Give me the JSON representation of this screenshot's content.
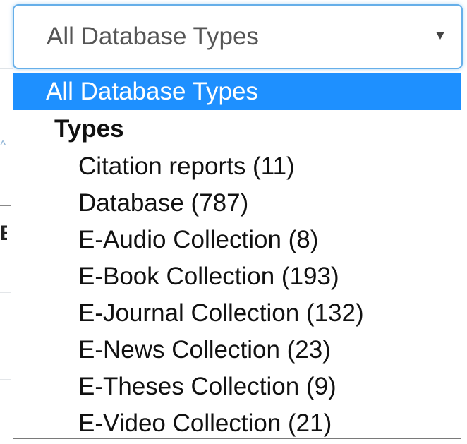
{
  "select": {
    "value": "All Database Types"
  },
  "dropdown": {
    "selected_option": "All Database Types",
    "group_label": "Types",
    "options": [
      "Citation reports (11)",
      "Database (787)",
      "E-Audio Collection (8)",
      "E-Book Collection (193)",
      "E-Journal Collection (132)",
      "E-News Collection (23)",
      "E-Theses Collection (9)",
      "E-Video Collection (21)"
    ]
  },
  "colors": {
    "selected_bg": "#1e90ff",
    "focus_border": "#66afe9",
    "text": "#111111",
    "select_text": "#555555"
  },
  "icons": {
    "caret": "chevron-down-icon"
  }
}
